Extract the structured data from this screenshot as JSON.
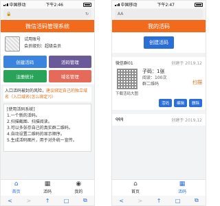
{
  "left": {
    "status": {
      "carrier": "中国移动",
      "time": "下午2:46"
    },
    "header_title": "微信活码管理系统",
    "profile": {
      "account": "试用账号",
      "level": "会员级别：超级会员"
    },
    "tiles": [
      "创建活码",
      "活码管理",
      "注册统计",
      "域名管理"
    ],
    "notice": {
      "text": "入口活码被封的风险，",
      "highlight": "建议绑定自己的独立域名（入口域名(怎么绑定?)）"
    },
    "help": {
      "title": "[使用活码系统]",
      "lines": [
        "1.一个新的活码。",
        "2.扫描截图、扫描阅读。",
        "3.可以多张存自己的真实群二维码。",
        "4.自动设置二维码的显示顺序。",
        "5.生成活码图片，用于对外统一宣传。"
      ]
    },
    "tabs": [
      {
        "label": "首页",
        "icon": "home-icon"
      },
      {
        "label": "活码",
        "icon": "qr-icon"
      },
      {
        "label": "我的",
        "icon": "user-icon"
      }
    ],
    "safari": [
      "<",
      ">",
      "↑",
      "□",
      "⧉"
    ]
  },
  "right": {
    "status": {
      "carrier": "中国移动",
      "time": "下午2:47"
    },
    "url_text": "AA",
    "header_title": "我的活码",
    "create_label": "创建活码",
    "cards": [
      {
        "name": "微信群01",
        "created": "创建于 2019.12",
        "sub_label": "下载活码大图",
        "qty": "子码：1张",
        "reads": "阅读：100次",
        "group_type": "群二维码",
        "scan": "扫描",
        "actions": [
          "活码",
          "编辑",
          "删除"
        ]
      },
      {
        "name": "qqq",
        "created": "创建于 2019.12"
      }
    ],
    "tabs": [
      {
        "label": "首页",
        "icon": "home-icon"
      },
      {
        "label": "活码",
        "icon": "qr-icon"
      }
    ]
  }
}
